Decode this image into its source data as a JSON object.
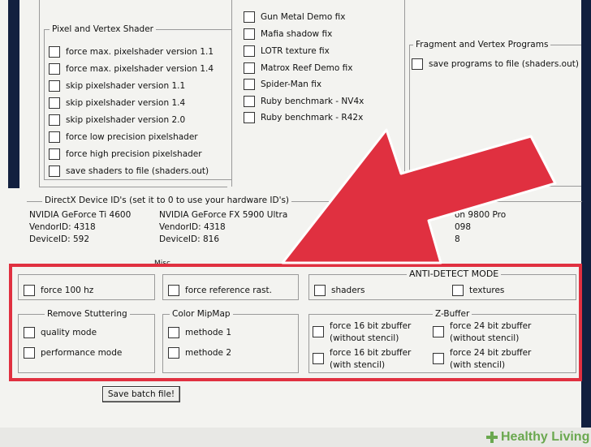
{
  "top_center_checks": [
    "Gun Metal Demo fix",
    "Mafia shadow fix",
    "LOTR texture fix",
    "Matrox Reef Demo fix",
    "Spider-Man fix",
    "Ruby benchmark - NV4x",
    "Ruby benchmark - R42x"
  ],
  "pixel_vertex_shader": {
    "title": "Pixel and Vertex Shader",
    "items": [
      "force max. pixelshader version 1.1",
      "force max. pixelshader version 1.4",
      "skip pixelshader version 1.1",
      "skip pixelshader version 1.4",
      "skip pixelshader version 2.0",
      "force low precision pixelshader",
      "force high precision pixelshader",
      "save shaders to file (shaders.out)"
    ]
  },
  "fragment_vertex_programs": {
    "title": "Fragment and Vertex Programs",
    "items": [
      "save programs to file (shaders.out)"
    ]
  },
  "device_ids": {
    "title": "DirectX Device ID's (set it to 0 to use your hardware ID's)",
    "columns": [
      [
        "NVIDIA GeForce Ti 4600",
        "VendorID: 4318",
        "DeviceID: 592"
      ],
      [
        "NVIDIA GeForce FX 5900 Ultra",
        "VendorID: 4318",
        "DeviceID: 816"
      ],
      [
        "on 9800 Pro",
        "098",
        "8"
      ]
    ]
  },
  "misc": {
    "title": "Misc",
    "items": [
      "force 100 hz",
      "force reference rast."
    ]
  },
  "anti_detect": {
    "title": "ANTI-DETECT MODE",
    "items": [
      "shaders",
      "textures"
    ]
  },
  "remove_stuttering": {
    "title": "Remove Stuttering",
    "items": [
      "quality mode",
      "performance mode"
    ]
  },
  "color_mipmap": {
    "title": "Color MipMap",
    "items": [
      "methode 1",
      "methode 2"
    ]
  },
  "zbuffer": {
    "title": "Z-Buffer",
    "items": [
      "force 16 bit zbuffer (without stencil)",
      "force 24 bit zbuffer (without stencil)",
      "force 16 bit zbuffer (with stencil)",
      "force 24 bit zbuffer (with stencil)"
    ]
  },
  "save_batch_button": "Save batch file!",
  "watermark": "Healthy Living",
  "colors": {
    "highlight_red": "#e03040",
    "navy": "#12203f",
    "watermark_green": "#6aa84f"
  }
}
